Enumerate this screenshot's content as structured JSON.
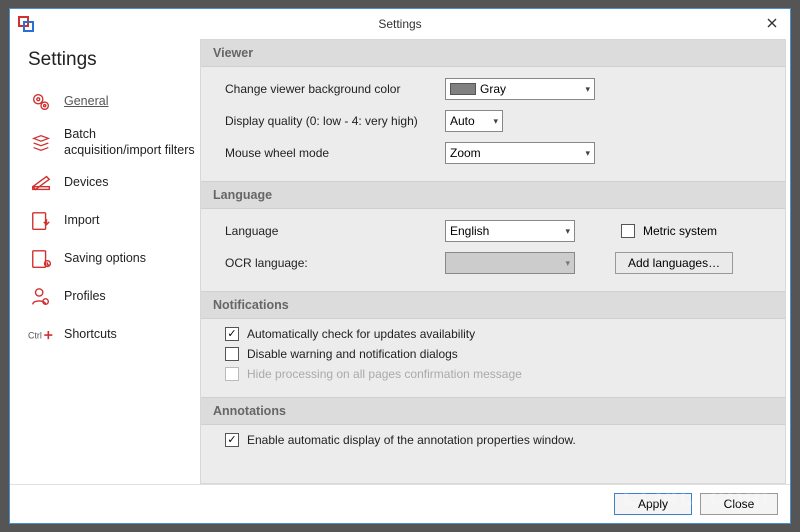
{
  "window": {
    "title": "Settings"
  },
  "sidebar": {
    "heading": "Settings",
    "items": [
      {
        "label": "General"
      },
      {
        "label": "Batch acquisition/import filters"
      },
      {
        "label": "Devices"
      },
      {
        "label": "Import"
      },
      {
        "label": "Saving options"
      },
      {
        "label": "Profiles"
      },
      {
        "label": "Shortcuts"
      }
    ]
  },
  "sections": {
    "viewer": {
      "heading": "Viewer",
      "bg_label": "Change viewer background color",
      "bg_value": "Gray",
      "quality_label": "Display quality (0: low - 4: very high)",
      "quality_value": "Auto",
      "wheel_label": "Mouse wheel mode",
      "wheel_value": "Zoom"
    },
    "language": {
      "heading": "Language",
      "lang_label": "Language",
      "lang_value": "English",
      "metric_label": "Metric system",
      "ocr_label": "OCR language:",
      "add_btn": "Add languages…"
    },
    "notifications": {
      "heading": "Notifications",
      "auto_update": "Automatically check for updates availability",
      "disable_warn": "Disable warning and notification dialogs",
      "hide_proc": "Hide processing on all pages confirmation message"
    },
    "annotations": {
      "heading": "Annotations",
      "enable": "Enable automatic display of the annotation properties window."
    }
  },
  "footer": {
    "apply": "Apply",
    "close": "Close"
  },
  "colors": {
    "gray_swatch": "#808080",
    "accent": "#3b7fcf"
  }
}
